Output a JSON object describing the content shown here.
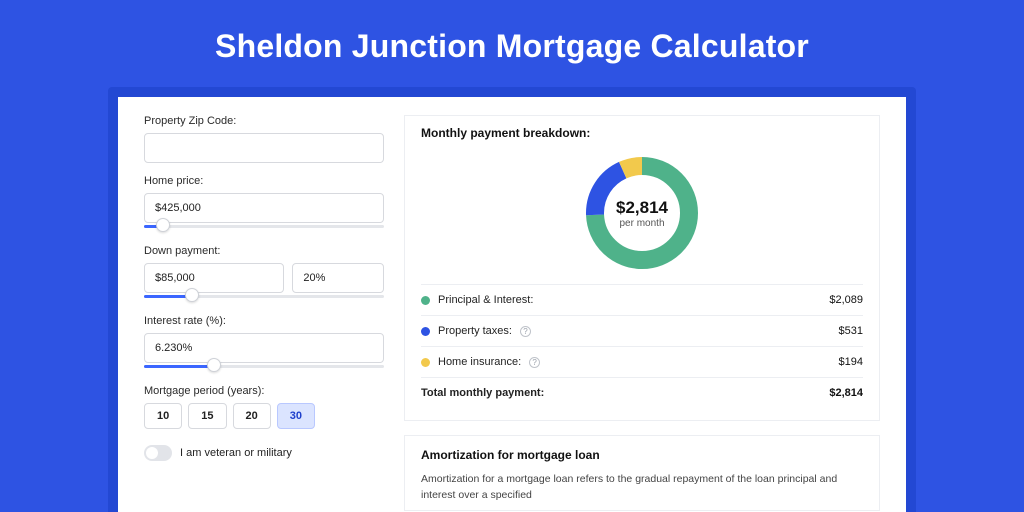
{
  "page": {
    "title": "Sheldon Junction Mortgage Calculator"
  },
  "form": {
    "zip": {
      "label": "Property Zip Code:",
      "value": ""
    },
    "price": {
      "label": "Home price:",
      "value": "$425,000",
      "slider_pct": 8
    },
    "down": {
      "label": "Down payment:",
      "value": "$85,000",
      "pct": "20%",
      "slider_pct": 20
    },
    "rate": {
      "label": "Interest rate (%):",
      "value": "6.230%",
      "slider_pct": 29
    },
    "period": {
      "label": "Mortgage period (years):",
      "options": [
        "10",
        "15",
        "20",
        "30"
      ],
      "selected": "30"
    },
    "veteran": {
      "label": "I am veteran or military",
      "checked": false
    }
  },
  "breakdown": {
    "title": "Monthly payment breakdown:",
    "center_amount": "$2,814",
    "center_sub": "per month",
    "items": [
      {
        "label": "Principal & Interest:",
        "value": "$2,089",
        "color": "#4fb28a",
        "help": false
      },
      {
        "label": "Property taxes:",
        "value": "$531",
        "color": "#2e53e3",
        "help": true
      },
      {
        "label": "Home insurance:",
        "value": "$194",
        "color": "#f2c94c",
        "help": true
      }
    ],
    "total": {
      "label": "Total monthly payment:",
      "value": "$2,814"
    }
  },
  "amortization": {
    "title": "Amortization for mortgage loan",
    "body": "Amortization for a mortgage loan refers to the gradual repayment of the loan principal and interest over a specified"
  },
  "chart_data": {
    "type": "pie",
    "title": "Monthly payment breakdown",
    "series": [
      {
        "name": "Principal & Interest",
        "value": 2089,
        "color": "#4fb28a"
      },
      {
        "name": "Property taxes",
        "value": 531,
        "color": "#2e53e3"
      },
      {
        "name": "Home insurance",
        "value": 194,
        "color": "#f2c94c"
      }
    ],
    "total": 2814,
    "center_label": "$2,814 per month"
  }
}
